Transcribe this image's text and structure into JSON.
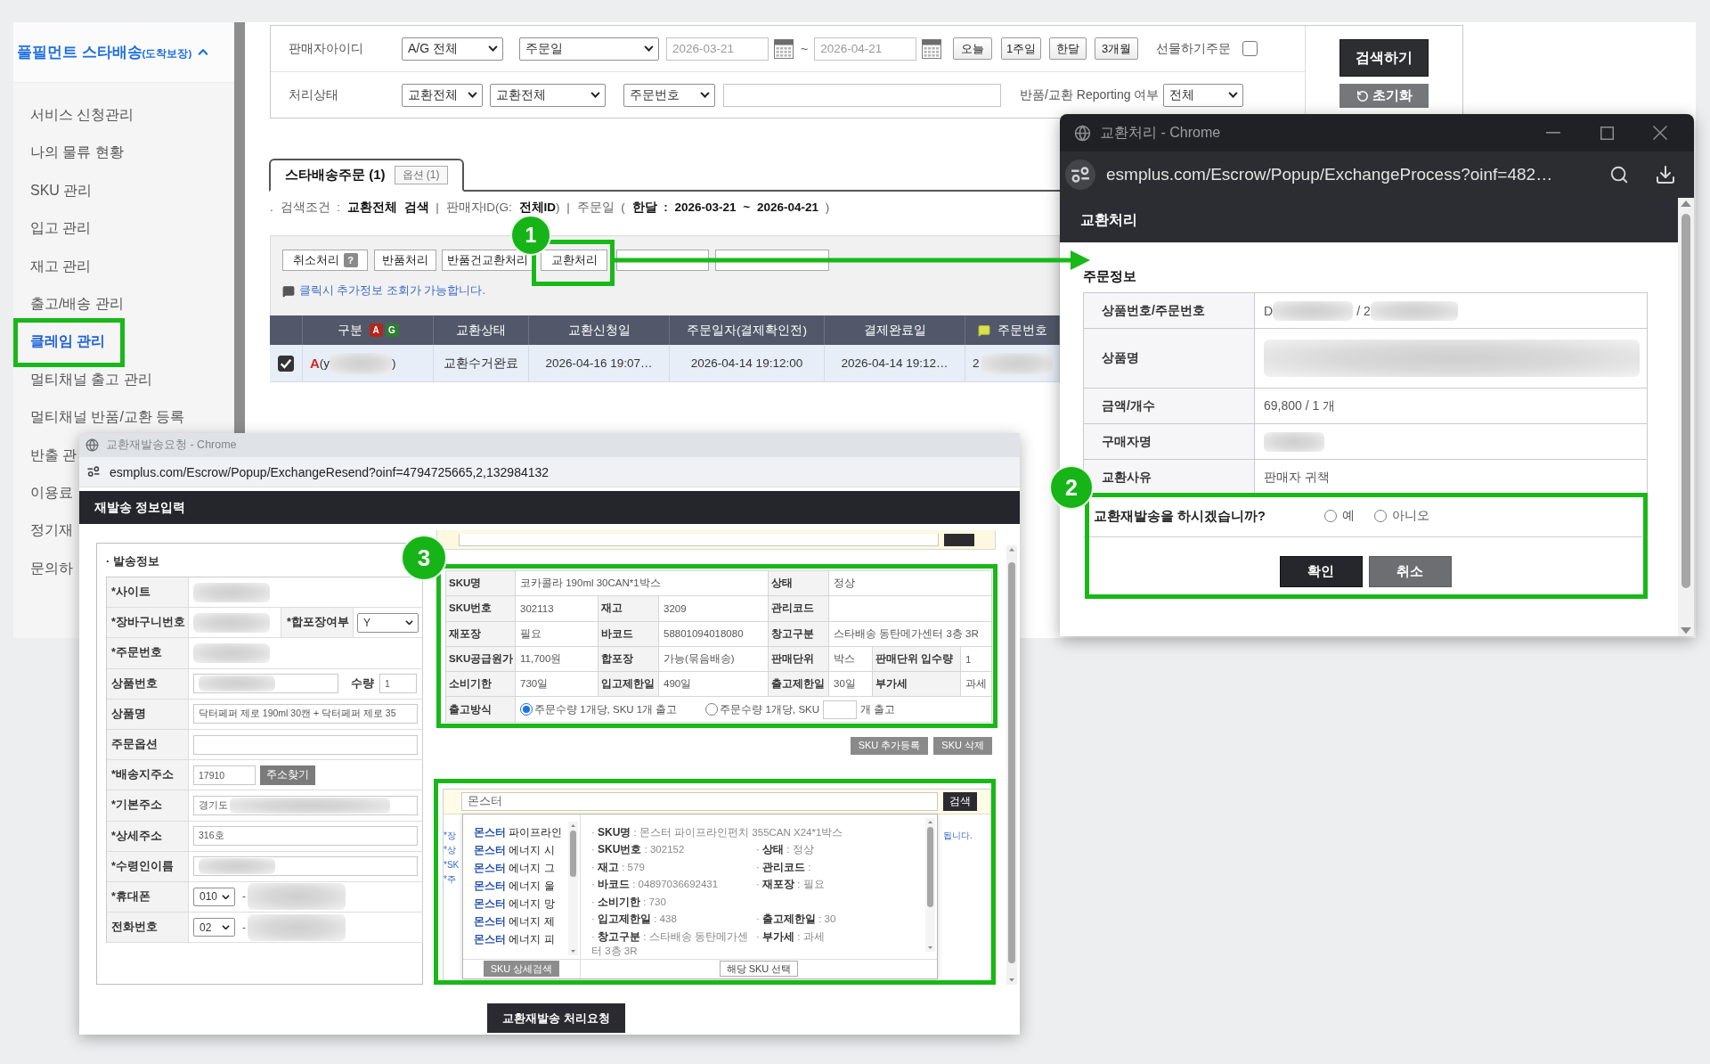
{
  "sidebar": {
    "title": "풀필먼트 스타배송",
    "title_note": "(도착보장)",
    "expanded": true,
    "items": [
      {
        "label": "서비스 신청관리",
        "selected": false
      },
      {
        "label": "나의 물류 현황",
        "selected": false
      },
      {
        "label": "SKU 관리",
        "selected": false
      },
      {
        "label": "입고 관리",
        "selected": false
      },
      {
        "label": "재고 관리",
        "selected": false
      },
      {
        "label": "출고/배송 관리",
        "selected": false
      },
      {
        "label": "클레임 관리",
        "selected": true
      },
      {
        "label": "멀티채널 출고 관리",
        "selected": false
      },
      {
        "label": "멀티채널 반품/교환 등록",
        "selected": false
      },
      {
        "label": "반출 관",
        "selected": false
      },
      {
        "label": "이용료",
        "selected": false
      },
      {
        "label": "정기재",
        "selected": false
      },
      {
        "label": "문의하",
        "selected": false
      }
    ]
  },
  "search_form": {
    "seller_label": "판매자아이디",
    "seller_select": "A/G 전체",
    "date_type_select": "주문일",
    "date_from": "2026-03-21",
    "date_separator": "~",
    "date_to": "2026-04-21",
    "period_buttons": [
      "오늘",
      "1주일",
      "한달",
      "3개월"
    ],
    "gift_label": "선물하기주문",
    "gift_checked": false,
    "status_label": "처리상태",
    "status_select": "교환전체",
    "status_detail_select": "교환전체",
    "keyword_type_select": "주문번호",
    "reporting_label": "반품/교환 Reporting 여부",
    "reporting_select": "전체",
    "search_button": "검색하기",
    "reset_button": "초기화"
  },
  "tabs": [
    {
      "label": "스타배송주문 (1)",
      "badge": "옵션 (1)",
      "selected": true
    }
  ],
  "search_summary": ". 검색조건 : **교환전체 검색** | 판매자ID(G: **전체ID**) | 주문일 ( **한달 : 2026-03-21 ~ 2026-04-21** )",
  "action_buttons": [
    {
      "kind": "help",
      "label": "취소처리",
      "help": "?"
    },
    {
      "kind": "plain",
      "label": "반품처리"
    },
    {
      "kind": "plain",
      "label": "반품건교환처리"
    },
    {
      "kind": "plain",
      "label": "교환처리"
    },
    {
      "kind": "covered"
    },
    {
      "kind": "covered"
    }
  ],
  "action_hint": "클릭시 추가정보 조회가 가능합니다.",
  "table": {
    "columns": [
      {
        "kind": "check"
      },
      {
        "kind": "badged",
        "label": "구분",
        "badges": [
          {
            "label": "A",
            "color": "#b3261e"
          },
          {
            "label": "G",
            "color": "#2e7d32"
          }
        ]
      },
      {
        "kind": "plain",
        "label": "교환상태"
      },
      {
        "kind": "plain",
        "label": "교환신청일"
      },
      {
        "kind": "plain",
        "label": "주문일자(결제확인전)"
      },
      {
        "kind": "plain",
        "label": "결제완료일"
      },
      {
        "kind": "iconed",
        "label": "주문번호"
      }
    ],
    "rows": [
      {
        "checked": true,
        "seller_mark": "A",
        "seller_prefix": "(y",
        "seller_suffix": ")",
        "status": "교환수거완료",
        "requested_at": "2026-04-16 19:07…",
        "ordered_at": "2026-04-14 19:12:00",
        "paid_at": "2026-04-14 19:12…",
        "order_no_prefix": "2"
      }
    ]
  },
  "exchange_popup": {
    "window_title": "교환처리 - Chrome",
    "url": "esmplus.com/Escrow/Popup/ExchangeProcess?oinf=482…",
    "header": "교환처리",
    "section_title": "주문정보",
    "fields": [
      {
        "kind": "redacted_pair",
        "label": "상품번호/주문번호",
        "prefix": "D",
        "middle": "/ 2"
      },
      {
        "kind": "redacted_block",
        "label": "상품명"
      },
      {
        "kind": "text",
        "label": "금액/개수",
        "value": "69,800 / 1 개"
      },
      {
        "kind": "redacted",
        "label": "구매자명"
      },
      {
        "kind": "text",
        "label": "교환사유",
        "value": "판매자 귀책"
      }
    ],
    "question": "교환재발송을 하시겠습니까?",
    "options": [
      {
        "label": "예",
        "selected": false
      },
      {
        "label": "아니오",
        "selected": false
      }
    ],
    "confirm_button": "확인",
    "cancel_button": "취소"
  },
  "resend_popup": {
    "window_title": "교환재발송요청 - Chrome",
    "url": "esmplus.com/Escrow/Popup/ExchangeResend?oinf=4794725665,2,132984132",
    "header": "재발송 정보입력",
    "section_title": "· 발송정보",
    "rows": [
      {
        "kind": "redacted",
        "label": "*사이트"
      },
      {
        "kind": "redacted_with_select",
        "label": "*장바구니번호",
        "side_label": "*합포장여부",
        "side_value": "Y"
      },
      {
        "kind": "redacted",
        "label": "*주문번호"
      },
      {
        "kind": "redacted_input_qty",
        "label": "상품번호",
        "side_label": "수량",
        "side_value": "1"
      },
      {
        "kind": "input",
        "label": "상품명",
        "value": "닥터페퍼 제로 190ml 30캔 + 닥터페퍼 제로 35"
      },
      {
        "kind": "input",
        "label": "주문옵션"
      },
      {
        "kind": "zipcode",
        "label": "*배송지주소",
        "value": "17910",
        "button": "주소찾기"
      },
      {
        "kind": "input_redacted",
        "label": "*기본주소",
        "value": "경기도"
      },
      {
        "kind": "input",
        "label": "*상세주소",
        "value": "316호"
      },
      {
        "kind": "redacted_input",
        "label": "*수령인이름"
      },
      {
        "kind": "phone",
        "label": "*휴대폰",
        "value": "010",
        "separator": "-"
      },
      {
        "kind": "phone",
        "label": "전화번호",
        "value": "02",
        "separator": "-"
      }
    ],
    "sku_detail": {
      "rows": [
        [
          {
            "label": "SKU명",
            "value": "코카콜라 190ml 30CAN*1박스"
          },
          "",
          {
            "label": "상태",
            "value": "정상"
          },
          ""
        ],
        [
          {
            "label": "SKU번호",
            "value": "302113"
          },
          {
            "label": "재고",
            "value": "3209"
          },
          {
            "label": "관리코드"
          },
          ""
        ],
        [
          {
            "label": "재포장",
            "value": "필요"
          },
          {
            "label": "바코드",
            "value": "58801094018080"
          },
          {
            "label": "창고구분",
            "value": "스타배송 동탄메가센터 3층 3R"
          },
          ""
        ],
        [
          {
            "label": "SKU공급원가",
            "value": "11,700원"
          },
          {
            "label": "합포장",
            "value": "가능(묶음배송)"
          },
          {
            "label": "판매단위",
            "value": "박스"
          },
          {
            "label": "판매단위 입수량",
            "value": "1"
          }
        ],
        [
          {
            "label": "소비기한",
            "value": "730일"
          },
          {
            "label": "입고제한일",
            "value": "490일"
          },
          {
            "label": "출고제한일",
            "value": "30일"
          },
          {
            "label": "부가세",
            "value": "과세"
          }
        ]
      ],
      "method_label": "출고방식",
      "method_options": [
        {
          "label": "주문수량 1개당, SKU 1개 출고",
          "selected": true
        },
        {
          "label": "주문수량 1개당, SKU",
          "suffix": "개 출고",
          "selected": false
        }
      ]
    },
    "sku_buttons": [
      "SKU 추가등록",
      "SKU 삭제"
    ],
    "sku_search": {
      "query": "몬스터",
      "button": "검색",
      "hints": [
        "*장",
        "*상",
        "*SK",
        "*주"
      ],
      "hint_end": "됩니다.",
      "results": [
        {
          "text": "**몬스터** 파이프라인",
          "selected": false
        },
        {
          "text": "**몬스터** 에너지 시",
          "selected": false
        },
        {
          "text": "**몬스터** 에너지 그",
          "selected": false
        },
        {
          "text": "**몬스터** 에너지 울",
          "selected": false
        },
        {
          "text": "**몬스터** 에너지 망",
          "selected": false
        },
        {
          "text": "**몬스터** 에너지 제",
          "selected": false
        },
        {
          "text": "**몬스터** 에너지 피",
          "selected": false
        }
      ],
      "details": [
        [
          "· **SKU명** : 몬스터 파이프라인펀치 355CAN X24*1박스"
        ],
        [
          "· **SKU번호** : 302152",
          "· **상태** : 정상"
        ],
        [
          "· **재고** : 579",
          "· **관리코드** :"
        ],
        [
          "· **바코드** : 04897036692431",
          "· **재포장** : 필요"
        ],
        [
          "· **소비기한** : 730"
        ],
        [
          "· **입고제한일** : 438",
          "· **출고제한일** : 30"
        ],
        [
          "· **창고구분** : 스타배송 동탄메가센터 3층 3R",
          "· **부가세** : 과세"
        ]
      ],
      "detail_button": "SKU 상세검색",
      "select_button": "해당 SKU 선택"
    },
    "submit_button": "교환재발송 처리요청"
  },
  "annotations": {
    "markers": [
      {
        "label": "1"
      },
      {
        "label": "2"
      },
      {
        "label": "3"
      }
    ]
  }
}
